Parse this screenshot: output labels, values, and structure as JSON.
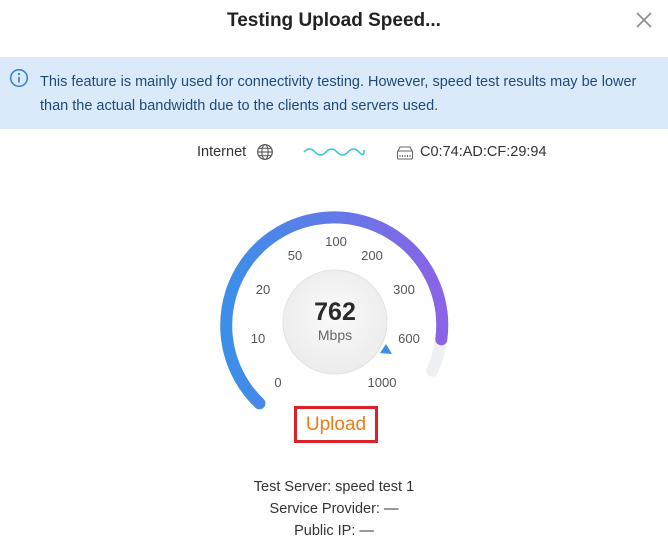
{
  "dialog": {
    "title": "Testing Upload Speed...",
    "close_icon": "close-icon"
  },
  "banner": {
    "icon": "info-icon",
    "text": "This feature is mainly used for connectivity testing. However, speed test results may be lower than the actual bandwidth due to the clients and servers used."
  },
  "path": {
    "internet_label": "Internet",
    "internet_icon": "globe-icon",
    "link_icon": "wave-icon",
    "device_icon": "router-icon",
    "device_mac": "C0:74:AD:CF:29:94"
  },
  "gauge": {
    "value": "762",
    "unit": "Mbps",
    "ticks": [
      "0",
      "10",
      "20",
      "50",
      "100",
      "200",
      "300",
      "600",
      "1000"
    ],
    "colors": {
      "start": "#3b8fe8",
      "end": "#8a63e6",
      "track": "#eef0f3",
      "needle": "#3b8fe8"
    }
  },
  "status": {
    "label": "Upload",
    "color": "#f07a1a"
  },
  "info": {
    "test_server": "Test Server: speed test 1",
    "service_provider": "Service Provider: —",
    "public_ip": "Public IP: —"
  }
}
